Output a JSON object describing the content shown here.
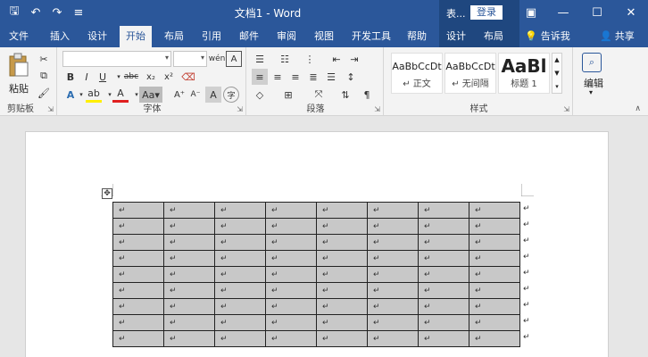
{
  "title_bar": {
    "doc_title": "文档1 - Word",
    "user_name": "表...",
    "login_label": "登录",
    "qat_icons": [
      "save-icon",
      "undo-icon",
      "redo-icon",
      "customize-icon"
    ]
  },
  "tabs": [
    {
      "label": "文件"
    },
    {
      "label": "插入"
    },
    {
      "label": "设计"
    },
    {
      "label": "开始"
    },
    {
      "label": "布局"
    },
    {
      "label": "引用"
    },
    {
      "label": "邮件"
    },
    {
      "label": "审阅"
    },
    {
      "label": "视图"
    },
    {
      "label": "开发工具"
    },
    {
      "label": "帮助"
    },
    {
      "label": "设计"
    },
    {
      "label": "布局"
    }
  ],
  "active_tab": "开始",
  "tell_me": "告诉我",
  "share": "共享",
  "ribbon": {
    "clipboard": {
      "paste_label": "粘贴",
      "group_label": "剪贴板"
    },
    "font": {
      "group_label": "字体",
      "font_name": "",
      "font_size": "",
      "format_buttons": [
        "B",
        "I",
        "U",
        "abc",
        "x₂",
        "x²"
      ]
    },
    "paragraph": {
      "group_label": "段落"
    },
    "styles": {
      "group_label": "样式",
      "items": [
        {
          "sample": "AaBbCcDt",
          "name": "↵ 正文"
        },
        {
          "sample": "AaBbCcDt",
          "name": "↵ 无间隔"
        },
        {
          "sample": "AaBl",
          "name": "标题 1"
        }
      ]
    },
    "editing": {
      "label": "编辑"
    }
  },
  "document": {
    "table": {
      "rows": 9,
      "cols": 8,
      "cell_mark": "↵"
    }
  }
}
